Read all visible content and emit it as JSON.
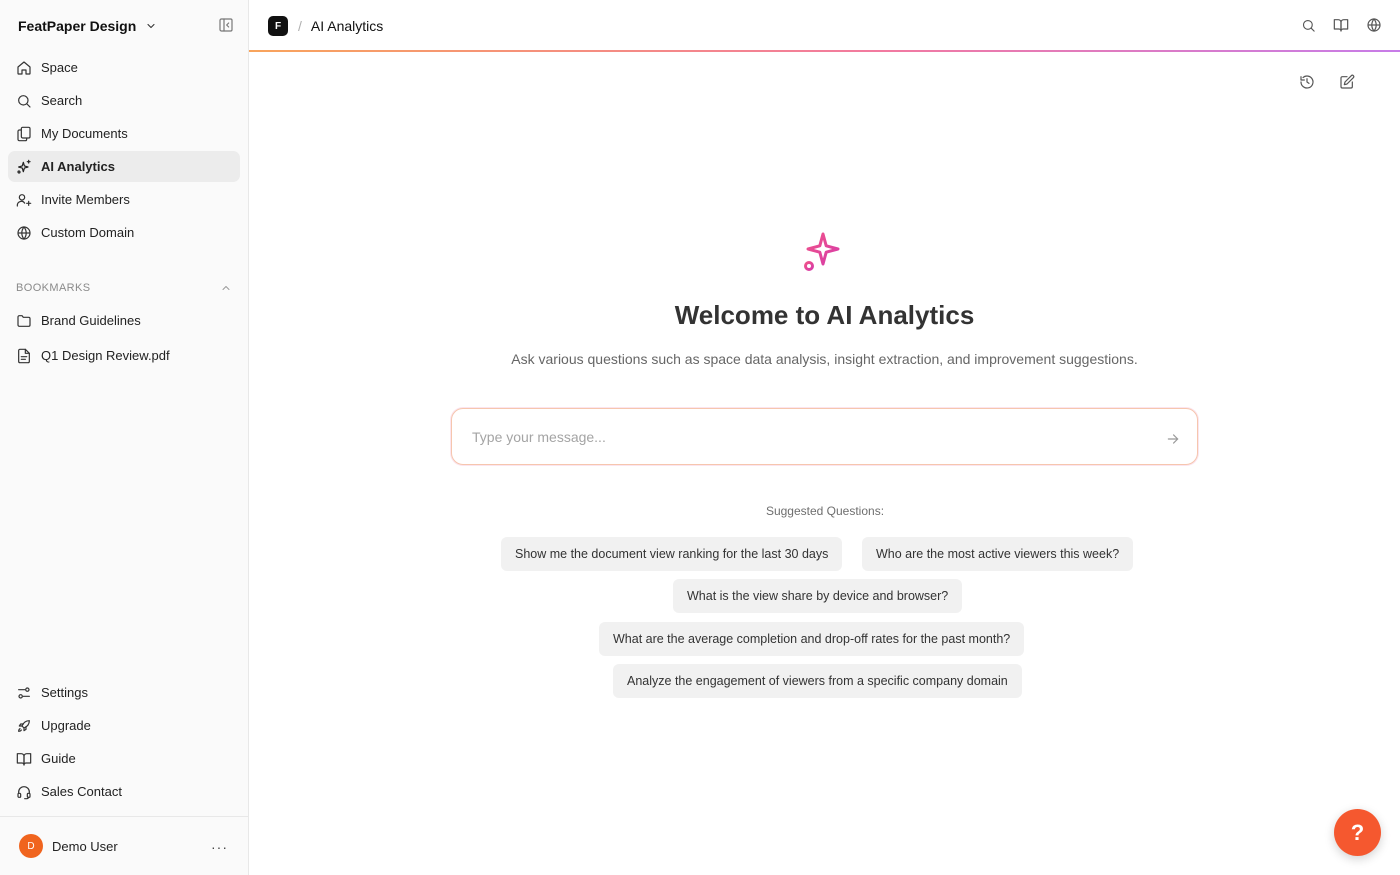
{
  "workspace": {
    "name": "FeatPaper Design"
  },
  "nav": {
    "items": [
      {
        "label": "Space",
        "icon": "home-icon"
      },
      {
        "label": "Search",
        "icon": "search-icon"
      },
      {
        "label": "My Documents",
        "icon": "documents-icon"
      },
      {
        "label": "AI Analytics",
        "icon": "sparkles-icon",
        "active": true
      },
      {
        "label": "Invite Members",
        "icon": "user-plus-icon"
      },
      {
        "label": "Custom Domain",
        "icon": "globe-icon"
      }
    ]
  },
  "bookmarks": {
    "title": "BOOKMARKS",
    "items": [
      {
        "label": "Brand Guidelines",
        "icon": "folder-icon"
      },
      {
        "label": "Q1 Design Review.pdf",
        "icon": "file-text-icon"
      }
    ]
  },
  "bottom_nav": {
    "items": [
      {
        "label": "Settings",
        "icon": "sliders-icon"
      },
      {
        "label": "Upgrade",
        "icon": "rocket-icon"
      },
      {
        "label": "Guide",
        "icon": "book-icon"
      },
      {
        "label": "Sales Contact",
        "icon": "headset-icon"
      }
    ]
  },
  "user": {
    "initial": "D",
    "name": "Demo User",
    "more": "···",
    "avatar_color": "#f0641e"
  },
  "topbar": {
    "logo_letter": "F",
    "separator": "/",
    "title": "AI Analytics"
  },
  "main": {
    "title": "Welcome to AI Analytics",
    "subtitle": "Ask various questions such as space data analysis, insight extraction, and improvement suggestions.",
    "input_placeholder": "Type your message...",
    "suggested_title": "Suggested Questions:",
    "suggestions": [
      "Show me the document view ranking for the last 30 days",
      "Who are the most active viewers this week?",
      "What is the view share by device and browser?",
      "What are the average completion and drop-off rates for the past month?",
      "Analyze the engagement of viewers from a specific company domain"
    ]
  },
  "help": {
    "label": "?"
  },
  "colors": {
    "accent": "#f5582f",
    "gradient_start": "#f8a45c",
    "gradient_end": "#c77ce8",
    "hero_icon": "#e9488f"
  }
}
